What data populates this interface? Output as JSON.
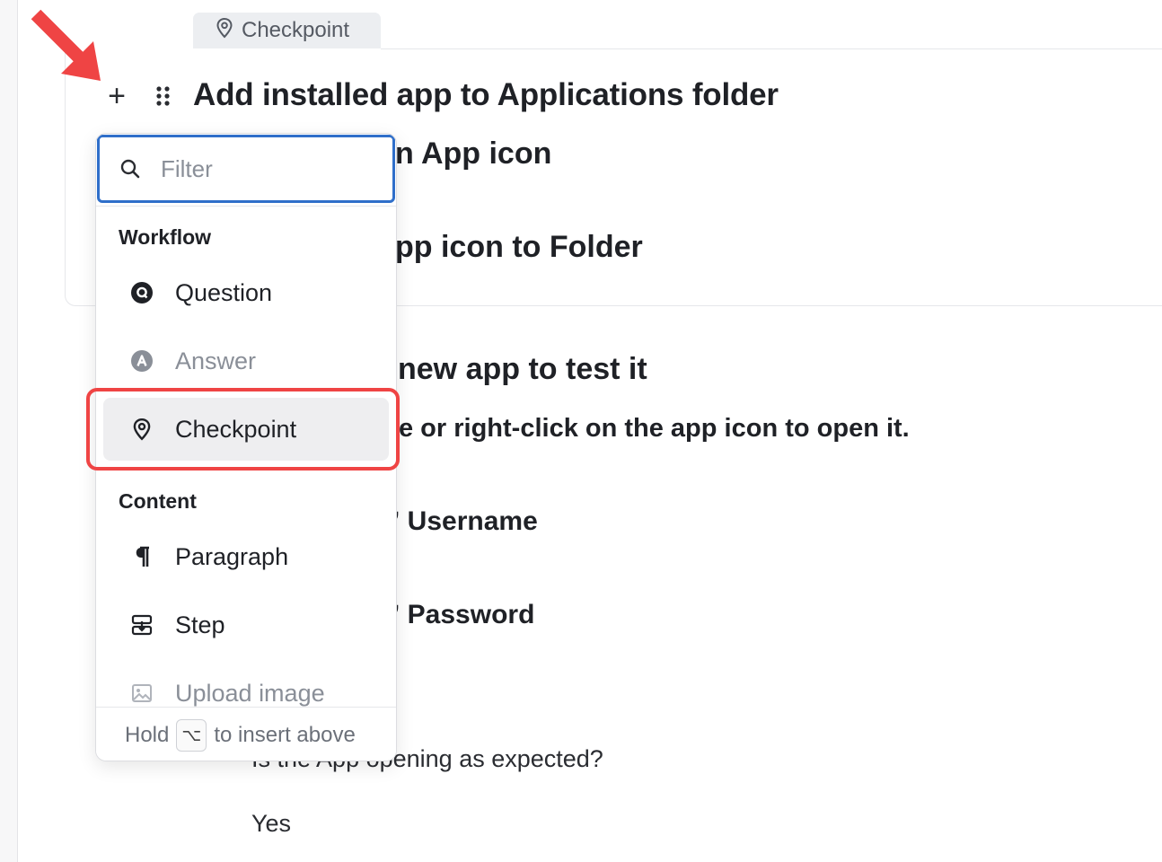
{
  "chip": {
    "label": "Checkpoint",
    "icon": "map-pin-icon"
  },
  "step": {
    "title": "Add installed app to Applications folder"
  },
  "background_lines": {
    "line1": "n App icon",
    "line2": "pp icon to Folder",
    "line3": "new app to test it",
    "line4": "e or right-click on the app icon to open it.",
    "line5": "ʼ Username",
    "line6": "ʼ Password",
    "question": "Is the App opening as expected?",
    "answer": "Yes"
  },
  "menu": {
    "filter": {
      "placeholder": "Filter",
      "value": ""
    },
    "sections": {
      "workflow": "Workflow",
      "content": "Content"
    },
    "items": {
      "question": {
        "label": "Question",
        "icon": "question-badge-icon"
      },
      "answer": {
        "label": "Answer",
        "icon": "answer-badge-icon"
      },
      "checkpoint": {
        "label": "Checkpoint",
        "icon": "map-pin-icon"
      },
      "paragraph": {
        "label": "Paragraph",
        "icon": "pilcrow-icon"
      },
      "step": {
        "label": "Step",
        "icon": "step-icon"
      },
      "upload_image": {
        "label": "Upload image",
        "icon": "image-icon"
      }
    },
    "footer": {
      "prefix": "Hold",
      "key": "⌥",
      "suffix": "to insert above"
    }
  },
  "colors": {
    "accent": "#2f6fca",
    "annotation": "#ef4444",
    "selected_bg": "#eeeef0"
  }
}
